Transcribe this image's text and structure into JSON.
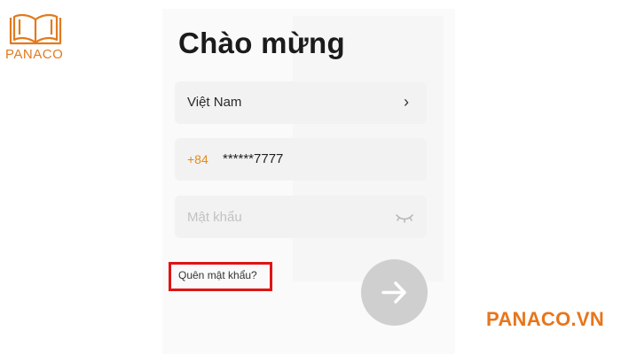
{
  "brand": {
    "logo_text": "PANACO",
    "accent_color": "#e8751a",
    "watermark": "PANACO.VN"
  },
  "screen": {
    "title": "Chào mừng"
  },
  "country_field": {
    "value": "Việt Nam",
    "icon": "chevron-right-icon"
  },
  "phone_field": {
    "prefix": "+84",
    "value": "******7777",
    "prefix_color": "#e58b1b"
  },
  "password_field": {
    "placeholder": "Mật khẩu",
    "value": "",
    "icon": "eye-closed-icon"
  },
  "forgot_password": {
    "label": "Quên mật khẩu?",
    "highlight_color": "#e01414"
  },
  "submit": {
    "icon": "arrow-right-icon",
    "state": "disabled"
  }
}
